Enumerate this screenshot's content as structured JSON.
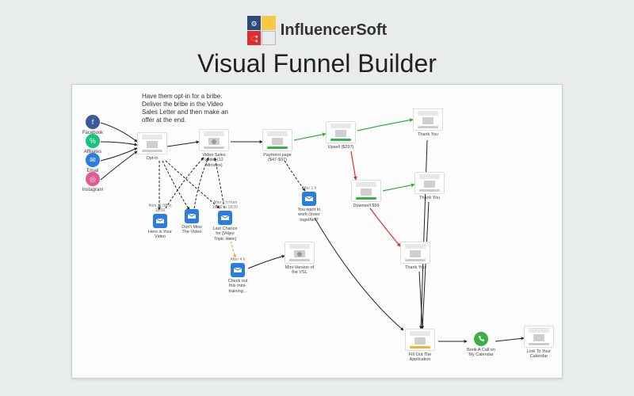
{
  "brand": {
    "name": "InfluencerSoft"
  },
  "title": "Visual Funnel Builder",
  "note": "Have them opt-in for a bribe. Deliver the bribe in the Video Sales Letter and then make an offer at the end.",
  "sources": {
    "facebook": {
      "label": "Facebook",
      "color": "#3b5998",
      "glyph": "f"
    },
    "affiliates": {
      "label": "Affiliates",
      "color": "#17c27b",
      "glyph": "%"
    },
    "email": {
      "label": "Email",
      "color": "#2b7de0",
      "glyph": "✉"
    },
    "instagram": {
      "label": "Instagram",
      "color": "#e35b93",
      "glyph": "◎"
    }
  },
  "pages": {
    "optin": {
      "label": "Opt-in",
      "accent": "#cccccc"
    },
    "vsl": {
      "label": "Video Sales Letter (12 Minutes)",
      "accent": "#cccccc",
      "icon": "play"
    },
    "payment": {
      "label": "Payment page ($47-$97)",
      "accent": "#37b24d"
    },
    "upsell": {
      "label": "Upsell ($297)",
      "accent": "#37b24d"
    },
    "downsell": {
      "label": "Downsell $99",
      "accent": "#37b24d"
    },
    "thankyou1": {
      "label": "Thank You",
      "accent": "#cccccc"
    },
    "thankyou2": {
      "label": "Thank You",
      "accent": "#cccccc"
    },
    "thankyou3": {
      "label": "Thank You",
      "accent": "#cccccc"
    },
    "mini_vsl": {
      "label": "Mini-Version of the VSL",
      "accent": "#cccccc",
      "icon": "play"
    },
    "application": {
      "label": "FIll Out The Application",
      "accent": "#f2b234"
    },
    "calendar_link": {
      "label": "Link To Your Calendar",
      "accent": "#cccccc"
    }
  },
  "emails": {
    "here_video": {
      "timing": "from 11:08 to 18:00",
      "label": "Here is Your Video"
    },
    "dont_miss": {
      "timing": "",
      "label": "Don't Miss The Video"
    },
    "last_chance": {
      "timing": "After 2 h from 16:30 to 18:00",
      "label": "Last Chance for [Video Topic Here]"
    },
    "checkout_mini": {
      "timing": "After 4 h",
      "label": "Check out this mini-training..."
    },
    "work_closer": {
      "timing": "After 1 h",
      "label": "You want to work closer together?"
    }
  },
  "phone": {
    "label": "Book A Call on My Calendar"
  }
}
